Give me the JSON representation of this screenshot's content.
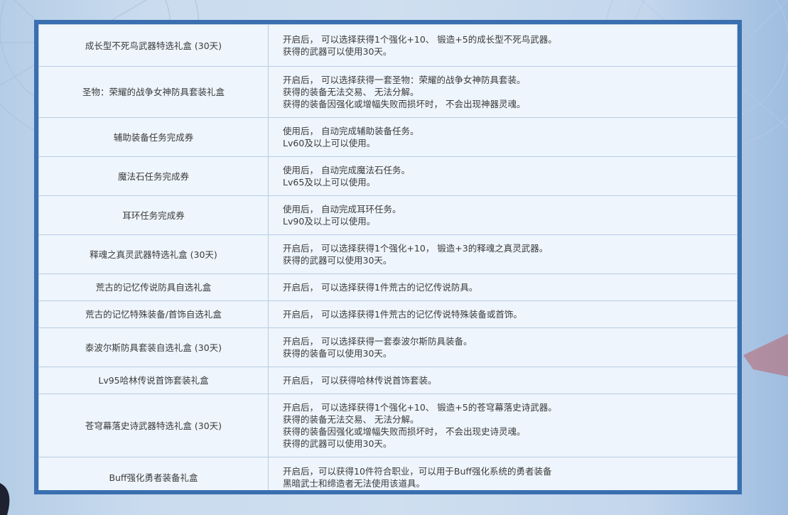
{
  "rows": [
    {
      "name": "成长型不死鸟武器特选礼盒 (30天)",
      "lines": [
        "开启后， 可以选择获得1个强化+10、 锻造+5的成长型不死鸟武器。",
        "获得的武器可以使用30天。"
      ]
    },
    {
      "name": "圣物：荣耀的战争女神防具套装礼盒",
      "lines": [
        "开启后， 可以选择获得一套圣物：荣耀的战争女神防具套装。",
        "获得的装备无法交易、 无法分解。",
        "获得的装备因强化或增幅失败而损坏时， 不会出现神器灵魂。"
      ]
    },
    {
      "name": "辅助装备任务完成券",
      "lines": [
        "使用后， 自动完成辅助装备任务。",
        "Lv60及以上可以使用。"
      ]
    },
    {
      "name": "魔法石任务完成券",
      "lines": [
        "使用后， 自动完成魔法石任务。",
        "Lv65及以上可以使用。"
      ]
    },
    {
      "name": "耳环任务完成券",
      "lines": [
        "使用后， 自动完成耳环任务。",
        "Lv90及以上可以使用。"
      ]
    },
    {
      "name": "释魂之真灵武器特选礼盒 (30天)",
      "lines": [
        "开启后， 可以选择获得1个强化+10， 锻造+3的释魂之真灵武器。",
        "获得的武器可以使用30天。"
      ]
    },
    {
      "name": "荒古的记忆传说防具自选礼盒",
      "lines": [
        "开启后， 可以选择获得1件荒古的记忆传说防具。"
      ]
    },
    {
      "name": "荒古的记忆特殊装备/首饰自选礼盒",
      "lines": [
        "开启后， 可以选择获得1件荒古的记忆传说特殊装备或首饰。"
      ]
    },
    {
      "name": "泰波尔斯防具套装自选礼盒 (30天)",
      "lines": [
        "开启后， 可以选择获得一套泰波尔斯防具装备。",
        "获得的装备可以使用30天。"
      ]
    },
    {
      "name": "Lv95哈林传说首饰套装礼盒",
      "lines": [
        "开启后， 可以获得哈林传说首饰套装。"
      ]
    },
    {
      "name": "苍穹幕落史诗武器特选礼盒 (30天)",
      "lines": [
        "开启后， 可以选择获得1个强化+10、 锻造+5的苍穹幕落史诗武器。",
        "获得的装备无法交易、 无法分解。",
        "获得的装备因强化或增幅失败而损坏时， 不会出现史诗灵魂。",
        "获得的武器可以使用30天。"
      ]
    },
    {
      "name": "Buff强化勇者装备礼盒",
      "lines": [
        "开启后，可以获得10件符合职业，可以用于Buff强化系统的勇者装备",
        "黑暗武士和缔造者无法使用该道具。"
      ]
    }
  ]
}
